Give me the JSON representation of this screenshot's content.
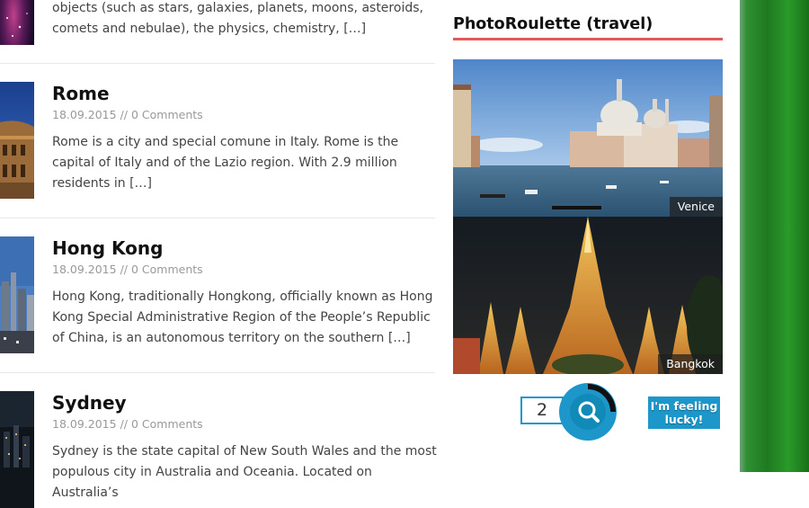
{
  "posts": [
    {
      "title": "",
      "date": "",
      "comments": "",
      "excerpt": "objects (such as stars, galaxies, planets, moons, asteroids, comets and nebulae), the physics, chemistry,",
      "more": "[…]"
    },
    {
      "title": "Rome",
      "date": "18.09.2015",
      "comments": "0 Comments",
      "excerpt": "Rome is a city and special comune in Italy. Rome is the capital of Italy and of the Lazio region. With 2.9 million residents in",
      "more": "[…]"
    },
    {
      "title": "Hong Kong",
      "date": "18.09.2015",
      "comments": "0 Comments",
      "excerpt": "Hong Kong, traditionally Hongkong, officially known as Hong Kong Special Administrative Region of the People’s Republic of China, is an autonomous territory on the southern",
      "more": "[…]"
    },
    {
      "title": "Sydney",
      "date": "18.09.2015",
      "comments": "0 Comments",
      "excerpt": "Sydney is the state capital of New South Wales and the most populous city in Australia and Oceania. Located on Australia’s",
      "more": ""
    }
  ],
  "meta_separator": "//",
  "sidebar": {
    "widget_title": "PhotoRoulette (travel)",
    "photos": [
      {
        "caption": "Venice"
      },
      {
        "caption": "Bangkok"
      }
    ],
    "count_value": "2",
    "lucky_line1": "I'm feeling",
    "lucky_line2": "lucky!"
  },
  "colors": {
    "accent_red": "#e05a5a",
    "button_blue": "#1d97c9",
    "background_green": "#2a8f2a"
  },
  "icons": {
    "search": "magnifier-icon"
  }
}
